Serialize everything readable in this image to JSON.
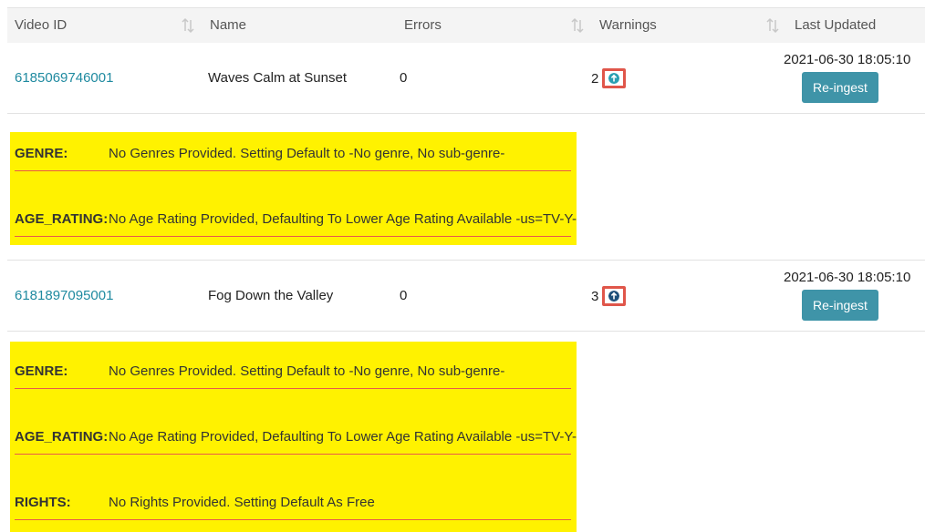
{
  "table": {
    "columns": [
      "Video ID",
      "Name",
      "Errors",
      "Warnings",
      "Last Updated"
    ]
  },
  "rows": [
    {
      "video_id": "6185069746001",
      "name": "Waves Calm at Sunset",
      "errors": "0",
      "warnings": "2",
      "last_updated": "2021-06-30 18:05:10",
      "action_label": "Re-ingest",
      "warning_details": [
        {
          "key": "GENRE:",
          "message": "No Genres Provided. Setting Default to -No genre, No sub-genre-"
        },
        {
          "key": "AGE_RATING:",
          "message": "No Age Rating Provided, Defaulting To Lower Age Rating Available -us=TV-Y-"
        }
      ]
    },
    {
      "video_id": "6181897095001",
      "name": "Fog Down the Valley",
      "errors": "0",
      "warnings": "3",
      "last_updated": "2021-06-30 18:05:10",
      "action_label": "Re-ingest",
      "warning_details": [
        {
          "key": "GENRE:",
          "message": "No Genres Provided. Setting Default to -No genre, No sub-genre-"
        },
        {
          "key": "AGE_RATING:",
          "message": "No Age Rating Provided, Defaulting To Lower Age Rating Available -us=TV-Y-"
        },
        {
          "key": "RIGHTS:",
          "message": "No Rights Provided. Setting Default As Free"
        }
      ]
    }
  ],
  "colors": {
    "link": "#1f8aa0",
    "button": "#3f94a8",
    "highlight": "#fff200",
    "warning_icon_first": "#2a9fb2",
    "warning_icon_second": "#1d4f7a",
    "callout_border": "#e0564a"
  },
  "icons": {
    "sort": "sort-arrows-icon",
    "toggle": "arrow-up-circle-icon"
  }
}
